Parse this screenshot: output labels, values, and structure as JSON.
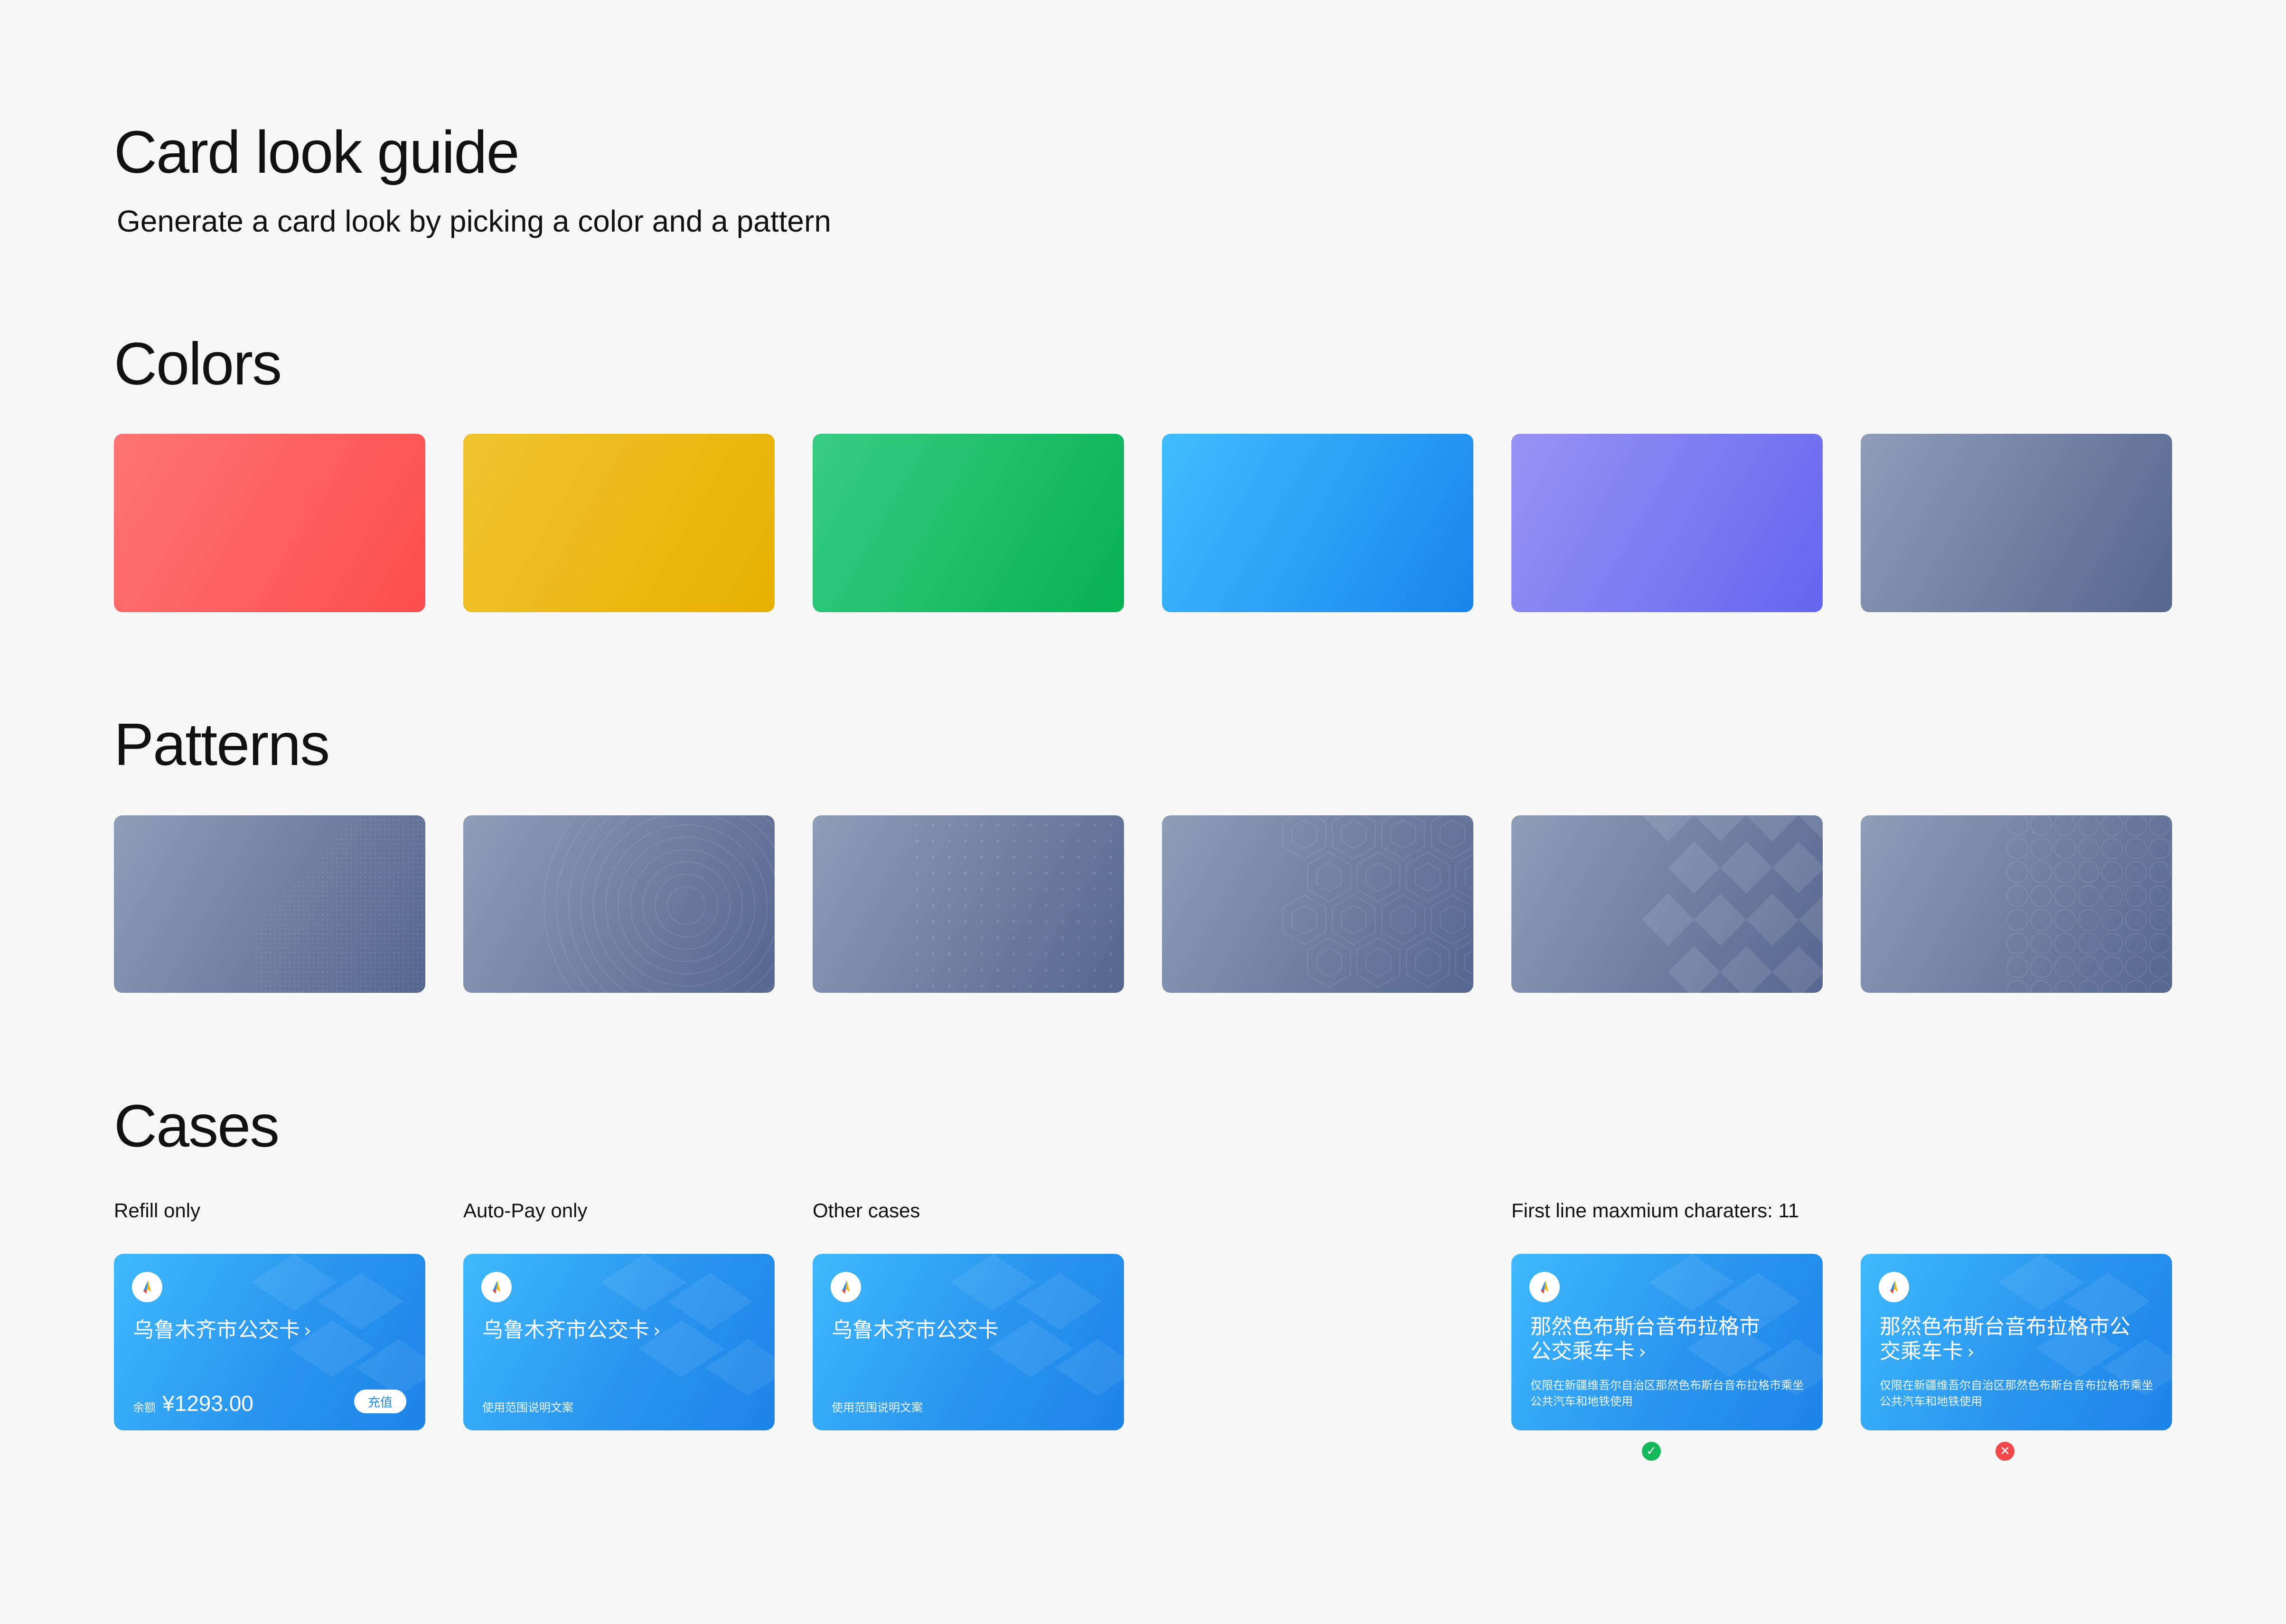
{
  "header": {
    "title": "Card look guide",
    "subtitle": "Generate a card look by picking a color and a pattern"
  },
  "colors": {
    "title": "Colors",
    "swatches": [
      {
        "name": "red",
        "from": "#ff7474",
        "to": "#fc4d4d"
      },
      {
        "name": "yellow",
        "from": "#f0c430",
        "to": "#e8b000"
      },
      {
        "name": "green",
        "from": "#37cd84",
        "to": "#07b152"
      },
      {
        "name": "blue",
        "from": "#40bdff",
        "to": "#1a84eb"
      },
      {
        "name": "purple",
        "from": "#9893f4",
        "to": "#6366ef"
      },
      {
        "name": "slate",
        "from": "#8f9db8",
        "to": "#55668f"
      }
    ]
  },
  "patterns": {
    "title": "Patterns",
    "items": [
      "dots",
      "waves",
      "dot-grid",
      "hexagons",
      "diamonds",
      "circles"
    ]
  },
  "cases": {
    "title": "Cases",
    "refill": {
      "caption": "Refill only",
      "card_name": "乌鲁木齐市公交卡",
      "balance_label": "余额",
      "balance_value": "¥1293.00",
      "refill_button": "充值"
    },
    "autopay": {
      "caption": "Auto-Pay only",
      "card_name": "乌鲁木齐市公交卡",
      "note": "使用范围说明文案"
    },
    "other": {
      "caption": "Other cases",
      "card_name": "乌鲁木齐市公交卡",
      "note": "使用范围说明文案"
    },
    "max_chars": {
      "caption": "First line maxmium charaters: 11",
      "good": {
        "card_name_line1": "那然色布斯台音布拉格市",
        "card_name_line2": "公交乘车卡",
        "desc": "仅限在新疆维吾尔自治区那然色布斯台音布拉格市乘坐公共汽车和地铁使用",
        "status_color": "#13b95a"
      },
      "bad": {
        "card_name_line1": "那然色布斯台音布拉格市公",
        "card_name_line2": "交乘车卡",
        "desc": "仅限在新疆维吾尔自治区那然色布斯台音布拉格市乘坐公共汽车和地铁使用",
        "status_color": "#f2484b"
      }
    }
  },
  "icons": {
    "check": "check-icon",
    "close": "close-icon",
    "chevron": "chevron-right-icon",
    "logo": "transit-logo-icon"
  }
}
